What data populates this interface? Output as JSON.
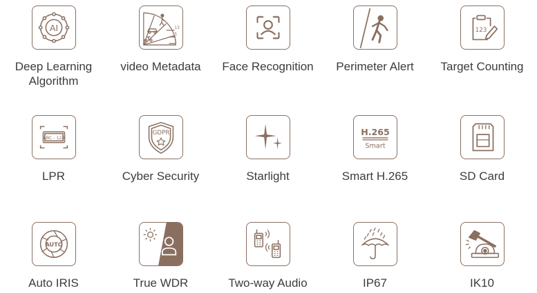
{
  "colors": {
    "icon": "#8a6f60",
    "text": "#3c3c3c",
    "fill": "#8a6f60",
    "background": "#ffffff"
  },
  "features": [
    {
      "label": "Deep Learning\nAlgorithm",
      "icon": "ai-chip-icon",
      "icon_text": "AI"
    },
    {
      "label": "video Metadata",
      "icon": "metadata-radar-icon",
      "icon_text": [
        "13",
        "5",
        "1"
      ]
    },
    {
      "label": "Face Recognition",
      "icon": "face-scan-icon"
    },
    {
      "label": "Perimeter Alert",
      "icon": "perimeter-intrusion-icon"
    },
    {
      "label": "Target Counting",
      "icon": "counting-clipboard-icon",
      "icon_text": "123"
    },
    {
      "label": "LPR",
      "icon": "license-plate-icon",
      "icon_text": "ABC - 123"
    },
    {
      "label": "Cyber Security",
      "icon": "gdpr-shield-icon",
      "icon_text": "GDPR"
    },
    {
      "label": "Starlight",
      "icon": "starlight-sparkle-icon"
    },
    {
      "label": "Smart H.265",
      "icon": "h265-codec-icon",
      "icon_text": [
        "H.265",
        "Smart"
      ]
    },
    {
      "label": "SD Card",
      "icon": "sd-card-icon"
    },
    {
      "label": "Auto IRIS",
      "icon": "auto-iris-icon",
      "icon_text": "AUTO"
    },
    {
      "label": "True WDR",
      "icon": "wdr-sun-person-icon"
    },
    {
      "label": "Two-way Audio",
      "icon": "walkie-talkie-icon"
    },
    {
      "label": "IP67",
      "icon": "rain-umbrella-icon"
    },
    {
      "label": "IK10",
      "icon": "hammer-camera-icon"
    }
  ]
}
